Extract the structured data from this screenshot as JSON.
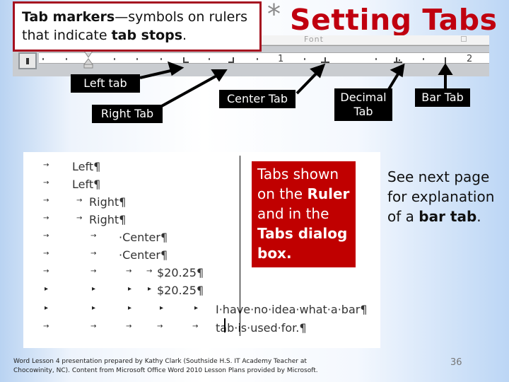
{
  "slide": {
    "title_bullet": "*",
    "title": "Setting Tabs",
    "page_number": "36",
    "colors": {
      "title": "#c0000f",
      "callout_box": "#c00000",
      "definition_border": "#a5101f",
      "label_bg": "#000000"
    }
  },
  "definition": {
    "term": "Tab markers",
    "dash_text": "—symbols on rulers that indicate ",
    "emphasis": "tab stops",
    "end": "."
  },
  "ribbon": {
    "group_label": "Font",
    "ruler_numbers": [
      "1",
      "2"
    ]
  },
  "labels": {
    "left_tab": "Left tab",
    "right_tab": "Right Tab",
    "center_tab": "Center Tab",
    "decimal_tab_line1": "Decimal",
    "decimal_tab_line2": "Tab",
    "bar_tab": "Bar Tab"
  },
  "document": {
    "lines": [
      {
        "text": "Left¶"
      },
      {
        "text": "Left¶"
      },
      {
        "text": "Right¶"
      },
      {
        "text": "Right¶"
      },
      {
        "text": "·Center¶"
      },
      {
        "text": "·Center¶"
      },
      {
        "text": "$20.25¶"
      },
      {
        "text": "$20.25¶"
      },
      {
        "text": "I·have·no·idea·what·a·bar¶"
      },
      {
        "text": "tab·is·used·for.¶"
      }
    ]
  },
  "callout": {
    "line1": "Tabs shown on the",
    "bold1": "Ruler",
    "line2": " and in the ",
    "bold2": "Tabs dialog box."
  },
  "note": {
    "text": "See next page for explanation of a ",
    "bold": "bar tab",
    "end": "."
  },
  "footer": {
    "line1": "Word Lesson 4 presentation prepared by Kathy Clark (Southside H.S. IT Academy Teacher at",
    "line2": "Chocowinity, NC). Content from Microsoft Office Word 2010 Lesson Plans provided by Microsoft."
  }
}
